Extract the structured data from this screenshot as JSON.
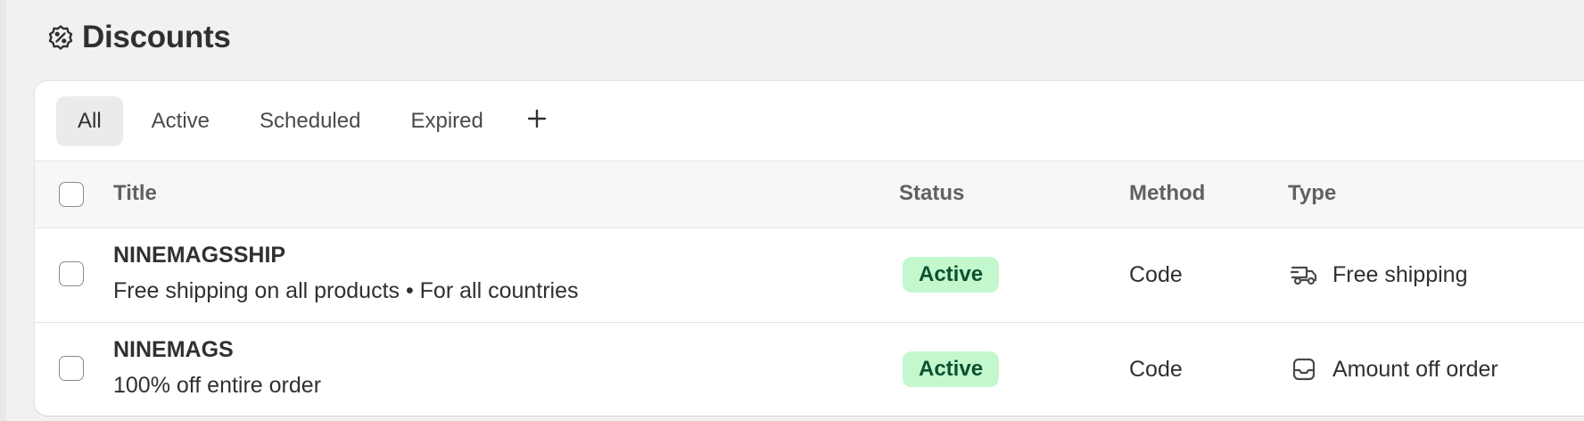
{
  "page": {
    "title": "Discounts",
    "title_icon": "discount-badge-icon"
  },
  "tabs": {
    "all": "All",
    "active": "Active",
    "scheduled": "Scheduled",
    "expired": "Expired",
    "selected": "All",
    "add_icon": "plus-icon"
  },
  "table": {
    "headers": {
      "title": "Title",
      "status": "Status",
      "method": "Method",
      "type": "Type"
    },
    "rows": [
      {
        "title": "NINEMAGSSHIP",
        "description": "Free shipping on all products • For all countries",
        "status": "Active",
        "method": "Code",
        "type": "Free shipping",
        "type_icon": "delivery-truck-icon"
      },
      {
        "title": "NINEMAGS",
        "description": "100% off entire order",
        "status": "Active",
        "method": "Code",
        "type": "Amount off order",
        "type_icon": "order-tray-icon"
      }
    ]
  },
  "colors": {
    "background": "#f1f1f1",
    "card": "#ffffff",
    "badge_active_bg": "#c3f8cc",
    "badge_active_text": "#0c5132",
    "selected_tab": "#ebebeb"
  }
}
